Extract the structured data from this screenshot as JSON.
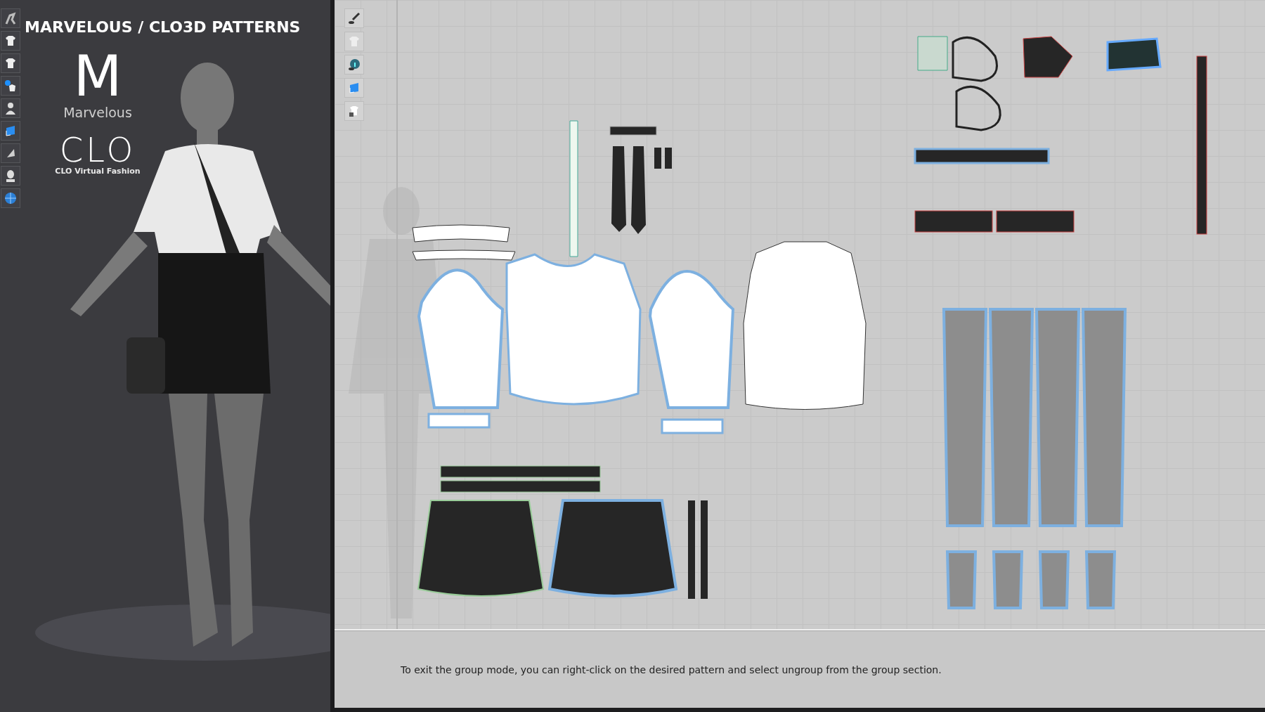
{
  "viewport_3d": {
    "title": "MARVELOUS / CLO3D PATTERNS",
    "logos": [
      {
        "kind": "marvelous",
        "mark": "M",
        "name": "Marvelous"
      },
      {
        "kind": "clo",
        "mark": "CLO",
        "name": "CLO Virtual Fashion"
      }
    ],
    "toolbar": [
      {
        "kind": "avatar-pose"
      },
      {
        "kind": "garment"
      },
      {
        "kind": "shirt"
      },
      {
        "kind": "shirt-point"
      },
      {
        "kind": "avatar"
      },
      {
        "kind": "fabric"
      },
      {
        "kind": "texture"
      },
      {
        "kind": "head"
      },
      {
        "kind": "globe"
      }
    ]
  },
  "pattern_window": {
    "toolbar": [
      {
        "kind": "pen"
      },
      {
        "kind": "shirt"
      },
      {
        "kind": "info"
      },
      {
        "kind": "fabric"
      },
      {
        "kind": "lock"
      }
    ],
    "caption": "To exit the group mode, you can right-click on the desired pattern and select ungroup from the group section."
  }
}
